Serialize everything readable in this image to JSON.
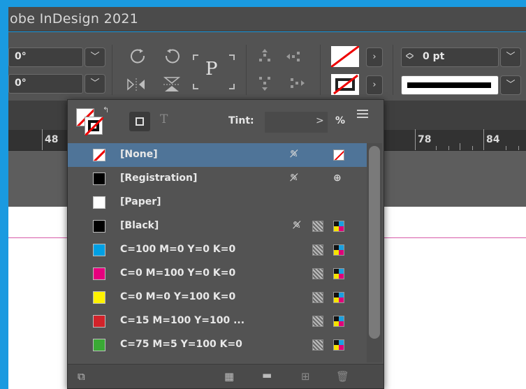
{
  "window": {
    "title": "obe InDesign 2021"
  },
  "control_bar": {
    "rotation_angle": "0°",
    "shear_angle": "0°",
    "stroke_weight": "0 pt",
    "dropdown_glyph": "﹀",
    "icons": [
      "rotate-cw-icon",
      "rotate-ccw-icon",
      "flip-horizontal-icon",
      "flip-vertical-icon",
      "reference-point-icon",
      "distribute-icon",
      "fill-swatch-icon",
      "stroke-swatch-icon",
      "stroke-style-icon"
    ],
    "reference_point_label": "P"
  },
  "ruler": {
    "labels": [
      "48",
      "78",
      "84"
    ]
  },
  "swatches_panel": {
    "tint_label": "Tint:",
    "tint_value": "",
    "tint_arrow": ">",
    "percent": "%",
    "text_button": "T",
    "swatches": [
      {
        "name": "[None]",
        "color": "none",
        "selected": true,
        "locked": true
      },
      {
        "name": "[Registration]",
        "color": "#000000",
        "selected": false,
        "locked": true
      },
      {
        "name": "[Paper]",
        "color": "#ffffff",
        "selected": false,
        "locked": false
      },
      {
        "name": "[Black]",
        "color": "#000000",
        "selected": false,
        "locked": true
      },
      {
        "name": "C=100 M=0 Y=0 K=0",
        "color": "#00a0e4",
        "selected": false,
        "locked": false
      },
      {
        "name": "C=0 M=100 Y=0 K=0",
        "color": "#e6007e",
        "selected": false,
        "locked": false
      },
      {
        "name": "C=0 M=0 Y=100 K=0",
        "color": "#fff200",
        "selected": false,
        "locked": false
      },
      {
        "name": "C=15 M=100 Y=100 ...",
        "color": "#d2232a",
        "selected": false,
        "locked": false
      },
      {
        "name": "C=75 M=5 Y=100 K=0",
        "color": "#3aaa35",
        "selected": false,
        "locked": false
      }
    ]
  },
  "colors": {
    "accent": "#1a9ae0",
    "selection": "#4f7498",
    "panel_bg": "#535353",
    "guide": "#d65aa8"
  }
}
